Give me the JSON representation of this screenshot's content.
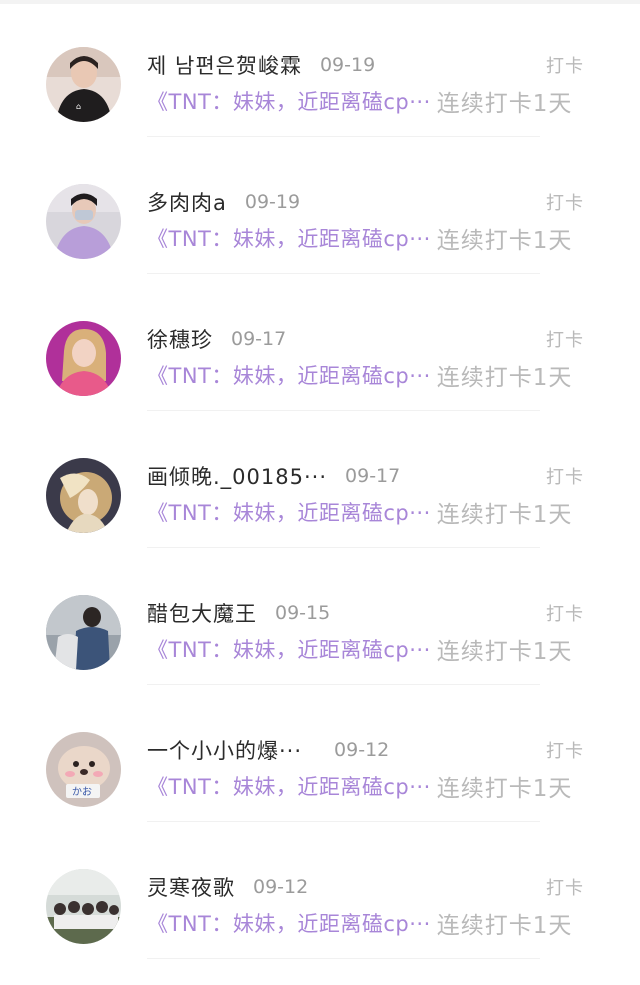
{
  "feed": {
    "items": [
      {
        "name": "제 남편은贺峻霖",
        "date": "09-19",
        "type": "打卡",
        "book": "《TNT：妹妹，近距离磕cp···",
        "streak": "连续打卡1天"
      },
      {
        "name": "多肉肉a",
        "date": "09-19",
        "type": "打卡",
        "book": "《TNT：妹妹，近距离磕cp···",
        "streak": "连续打卡1天"
      },
      {
        "name": "徐穗珍",
        "date": "09-17",
        "type": "打卡",
        "book": "《TNT：妹妹，近距离磕cp···",
        "streak": "连续打卡1天"
      },
      {
        "name": "画倾晚._00185···",
        "date": "09-17",
        "type": "打卡",
        "book": "《TNT：妹妹，近距离磕cp···",
        "streak": "连续打卡1天"
      },
      {
        "name": "醋包大魔王",
        "date": "09-15",
        "type": "打卡",
        "book": "《TNT：妹妹，近距离磕cp···",
        "streak": "连续打卡1天"
      },
      {
        "name": "一个小小的爆···",
        "date": "09-12",
        "type": "打卡",
        "book": "《TNT：妹妹，近距离磕cp···",
        "streak": "连续打卡1天"
      },
      {
        "name": "灵寒夜歌",
        "date": "09-12",
        "type": "打卡",
        "book": "《TNT：妹妹，近距离磕cp···",
        "streak": "连续打卡1天"
      }
    ]
  },
  "colors": {
    "name": "#2b2b2b",
    "date": "#9b9b9b",
    "book_link": "#a886d8",
    "muted": "#b9b9b9"
  }
}
